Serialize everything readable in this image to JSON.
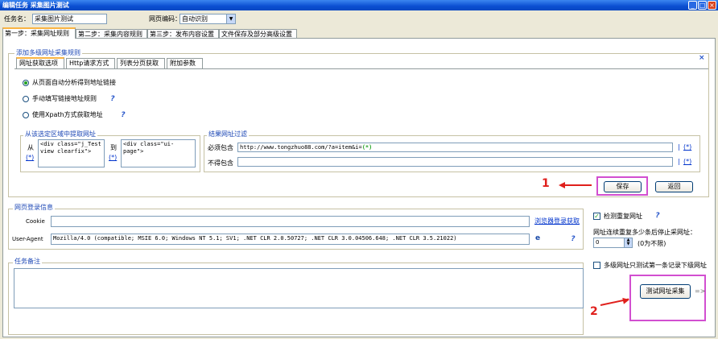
{
  "window": {
    "title": "编辑任务  采集图片测试"
  },
  "header": {
    "task_name_label": "任务名：",
    "task_name_value": "采集图片测试",
    "encoding_label": "网页编码：",
    "encoding_value": "自动识别"
  },
  "tabs": [
    {
      "label": "第一步：采集网址规则"
    },
    {
      "label": "第二步：采集内容规则"
    },
    {
      "label": "第三步：发布内容设置"
    },
    {
      "label": "文件保存及部分高级设置"
    }
  ],
  "multi_url": {
    "group_title": "添加多级网址采集规则",
    "subtabs": [
      {
        "label": "网址获取选项"
      },
      {
        "label": "Http请求方式"
      },
      {
        "label": "列表分页获取"
      },
      {
        "label": "附加参数"
      }
    ],
    "options": [
      {
        "label": "从页面自动分析得到地址链接"
      },
      {
        "label": "手动填写链接地址规则"
      },
      {
        "label": "使用Xpath方式获取地址"
      }
    ],
    "region_title": "从该选定区域中提取网址",
    "from_label": "从",
    "from_value": "<div class=\"j_Test\nview clearfix\">",
    "to_label": "到",
    "to_value": "<div class=\"ui-page\">",
    "paren_link": "(*)",
    "filter_title": "结果网址过滤",
    "must_contain_label": "必须包含",
    "must_contain_value": "http://www.tongzhuo88.com/?a=item&i=",
    "must_contain_suffix": "(*)",
    "exclude_label": "不得包含",
    "exclude_value": "",
    "pipe_link": "|",
    "save_button": "保存",
    "back_button": "返回"
  },
  "login": {
    "group_title": "网页登录信息",
    "cookie_label": "Cookie",
    "cookie_value": "",
    "browser_login_link": "浏览器登录获取",
    "ua_label": "User-Agent",
    "ua_value": "Mozilla/4.0 (compatible; MSIE 6.0; Windows NT 5.1; SV1; .NET CLR 2.0.50727; .NET CLR 3.0.04506.648; .NET CLR 3.5.21022)",
    "ua_icon_text": "e"
  },
  "right_panel": {
    "dedupe_label": "检测重复网址",
    "dedupe_checked": true,
    "stop_label": "网址连续重复多少条后停止采网址：",
    "stop_value": "0",
    "stop_hint": "(0为不限)",
    "first_only_label": "多级网址只测试第一条记录下级网址",
    "first_only_checked": false,
    "test_button": "测试网址采集",
    "arrow_text": "=>"
  },
  "notes": {
    "group_title": "任务备注",
    "value": ""
  },
  "annotations": {
    "n1": "1",
    "n2": "2",
    "color": "#e0201c",
    "highlight_color": "#d24fd0"
  }
}
